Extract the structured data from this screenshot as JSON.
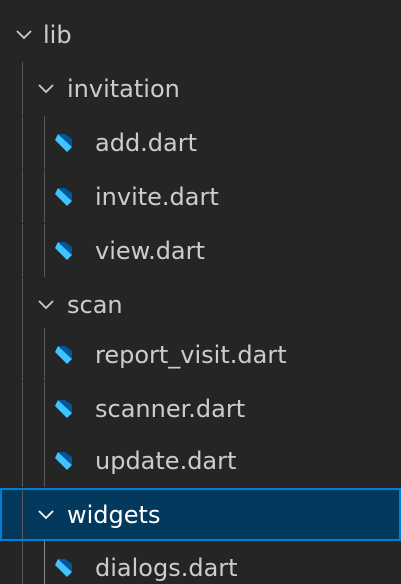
{
  "explorer": {
    "accent": "#007fd4",
    "root": {
      "label": "lib",
      "icon": "chevron-down-icon"
    },
    "folders": [
      {
        "label": "invitation",
        "icon": "chevron-down-icon",
        "files": [
          {
            "label": "add.dart",
            "icon": "dart-file-icon"
          },
          {
            "label": "invite.dart",
            "icon": "dart-file-icon"
          },
          {
            "label": "view.dart",
            "icon": "dart-file-icon"
          }
        ]
      },
      {
        "label": "scan",
        "icon": "chevron-down-icon",
        "files": [
          {
            "label": "report_visit.dart",
            "icon": "dart-file-icon"
          },
          {
            "label": "scanner.dart",
            "icon": "dart-file-icon"
          },
          {
            "label": "update.dart",
            "icon": "dart-file-icon"
          }
        ]
      },
      {
        "label": "widgets",
        "icon": "chevron-down-icon",
        "selected": true,
        "files": [
          {
            "label": "dialogs.dart",
            "icon": "dart-file-icon"
          }
        ]
      }
    ]
  }
}
